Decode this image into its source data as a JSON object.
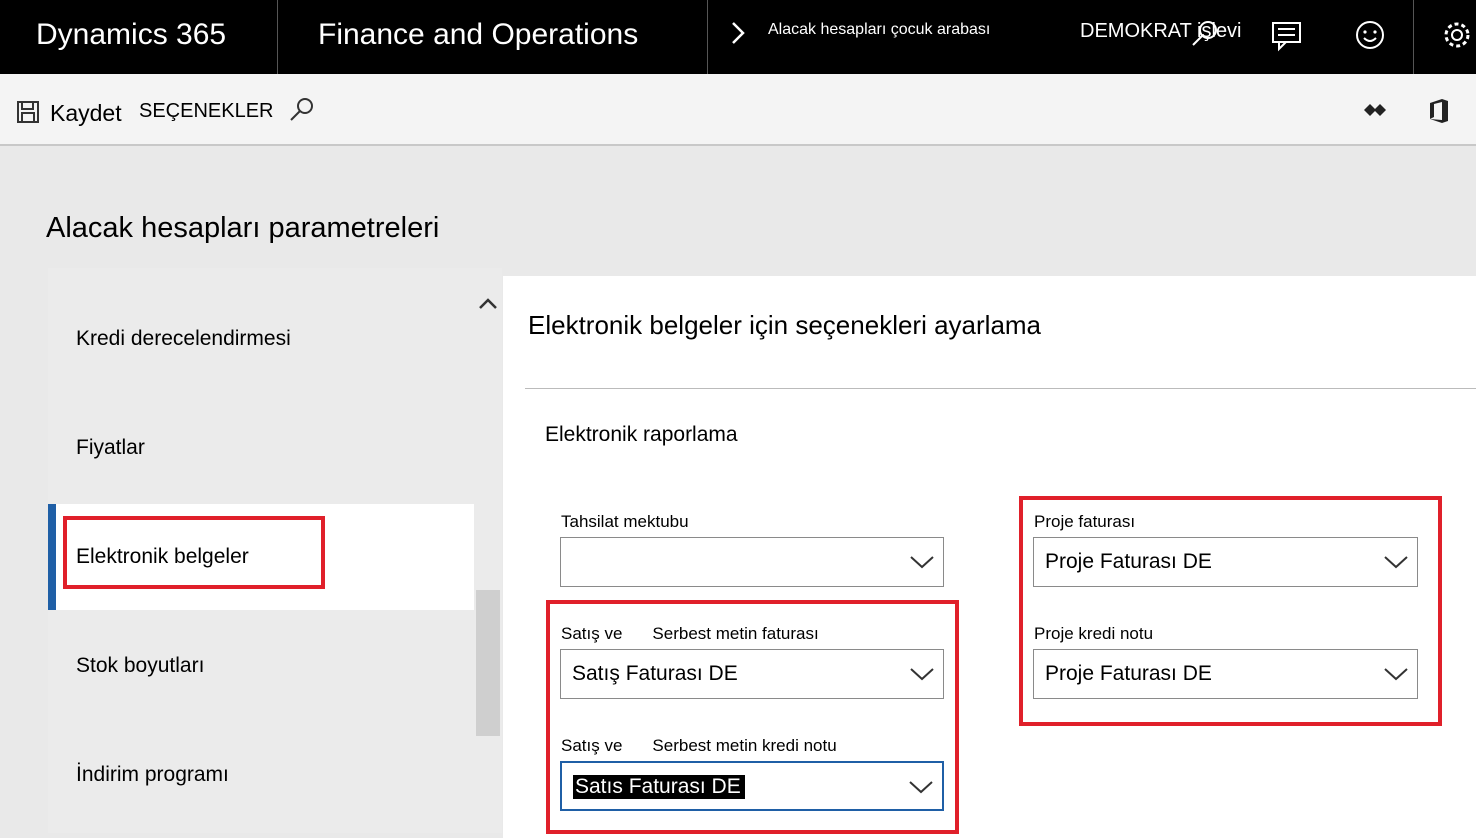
{
  "header": {
    "product": "Dynamics 365",
    "app": "Finance and Operations",
    "breadcrumb": "Alacak hesapları çocuk arabası",
    "company": "DEMOKRAT işlevi"
  },
  "toolbar": {
    "save_label": "Kaydet",
    "options_label": "SEÇENEKLER"
  },
  "page": {
    "title": "Alacak hesapları parametreleri"
  },
  "nav": {
    "items": [
      {
        "label": "Kredi derecelendirmesi"
      },
      {
        "label": "Fiyatlar"
      },
      {
        "label": "Elektronik belgeler"
      },
      {
        "label": "Stok boyutları"
      },
      {
        "label": "İndirim programı"
      }
    ],
    "active": "Elektronik belgeler"
  },
  "panel": {
    "section_title": "Elektronik belgeler için seçenekleri ayarlama",
    "group_title": "Elektronik raporlama",
    "fields": {
      "collection_letter": {
        "label": "Tahsilat mektubu",
        "value": ""
      },
      "sales_invoice": {
        "label_a": "Satış ve",
        "label_b": "Serbest metin faturası",
        "value": "Satış Faturası DE"
      },
      "sales_credit_note": {
        "label_a": "Satış ve",
        "label_b": "Serbest metin kredi notu",
        "value": "Satıs Faturası DE"
      },
      "project_invoice": {
        "label": "Proje faturası",
        "value": "Proje Faturası DE"
      },
      "project_credit_note": {
        "label": "Proje kredi notu",
        "value": "Proje Faturası DE"
      }
    }
  },
  "colors": {
    "header_bg": "#000000",
    "accent": "#1f5fa6",
    "highlight_box": "#e0202a"
  },
  "icons": [
    "chevron-right-icon",
    "search-icon",
    "chat-icon",
    "smiley-icon",
    "gear-icon",
    "save-icon",
    "diamond-icon",
    "office-icon",
    "chevron-up-icon",
    "chevron-down-icon"
  ]
}
